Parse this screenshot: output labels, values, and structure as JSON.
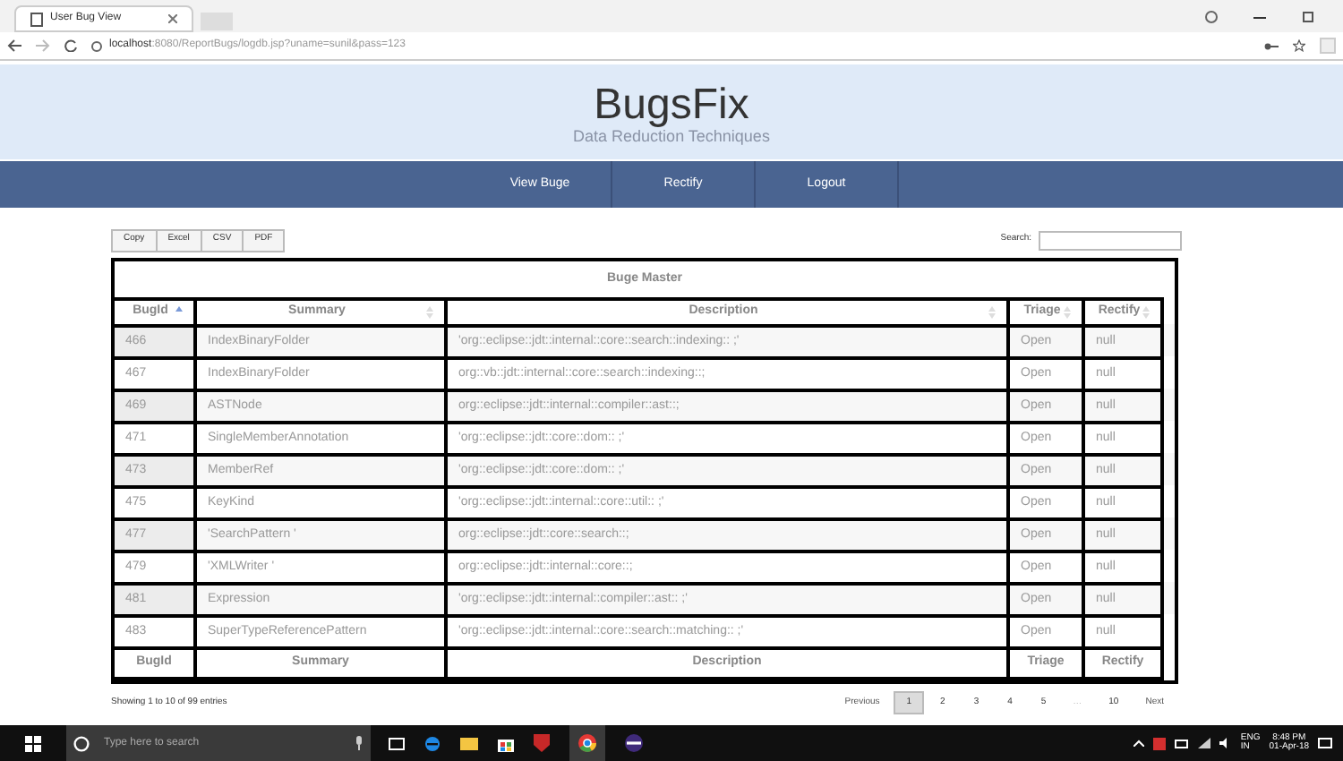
{
  "browser": {
    "tab_title": "User Bug View",
    "url_host": "localhost",
    "url_path": ":8080/ReportBugs/logdb.jsp?uname=sunil&pass=123"
  },
  "header": {
    "title": "BugsFix",
    "subtitle": "Data Reduction Techniques"
  },
  "nav": [
    "View Buge",
    "Rectify",
    "Logout"
  ],
  "export_buttons": [
    "Copy",
    "Excel",
    "CSV",
    "PDF"
  ],
  "search": {
    "label": "Search:"
  },
  "table": {
    "caption": "Buge Master",
    "columns": [
      {
        "label": "BugId",
        "sorted": true
      },
      {
        "label": "Summary",
        "sorted": false
      },
      {
        "label": "Description",
        "sorted": false
      },
      {
        "label": "Triage",
        "sorted": false
      },
      {
        "label": "Rectify",
        "sorted": false
      }
    ],
    "rows": [
      [
        "466",
        "IndexBinaryFolder",
        "'org::eclipse::jdt::internal::core::search::indexing:: ;'",
        "Open",
        "null"
      ],
      [
        "467",
        "IndexBinaryFolder",
        "org::vb::jdt::internal::core::search::indexing::;",
        "Open",
        "null"
      ],
      [
        "469",
        "ASTNode",
        "org::eclipse::jdt::internal::compiler::ast::;",
        "Open",
        "null"
      ],
      [
        "471",
        "SingleMemberAnnotation",
        "'org::eclipse::jdt::core::dom:: ;'",
        "Open",
        "null"
      ],
      [
        "473",
        "MemberRef",
        "'org::eclipse::jdt::core::dom:: ;'",
        "Open",
        "null"
      ],
      [
        "475",
        "KeyKind",
        "'org::eclipse::jdt::internal::core::util:: ;'",
        "Open",
        "null"
      ],
      [
        "477",
        "'SearchPattern '",
        "org::eclipse::jdt::core::search::;",
        "Open",
        "null"
      ],
      [
        "479",
        "'XMLWriter '",
        "org::eclipse::jdt::internal::core::;",
        "Open",
        "null"
      ],
      [
        "481",
        "Expression",
        "'org::eclipse::jdt::internal::compiler::ast:: ;'",
        "Open",
        "null"
      ],
      [
        "483",
        "SuperTypeReferencePattern",
        "'org::eclipse::jdt::internal::core::search::matching:: ;'",
        "Open",
        "null"
      ]
    ],
    "footer": [
      "BugId",
      "Summary",
      "Description",
      "Triage",
      "Rectify"
    ]
  },
  "info": "Showing 1 to 10 of 99 entries",
  "pagination": [
    {
      "label": "Previous",
      "kind": "nav"
    },
    {
      "label": "1",
      "kind": "page",
      "selected": true
    },
    {
      "label": "2",
      "kind": "page",
      "selected": false
    },
    {
      "label": "3",
      "kind": "page",
      "selected": false
    },
    {
      "label": "4",
      "kind": "page",
      "selected": false
    },
    {
      "label": "5",
      "kind": "page",
      "selected": false
    },
    {
      "label": "…",
      "kind": "gap"
    },
    {
      "label": "10",
      "kind": "page",
      "selected": false
    },
    {
      "label": "Next",
      "kind": "nav"
    }
  ],
  "taskbar": {
    "search_placeholder": "Type here to search",
    "language": "ENG",
    "region": "IN",
    "time": "8:48 PM",
    "date": "01-Apr-18"
  }
}
